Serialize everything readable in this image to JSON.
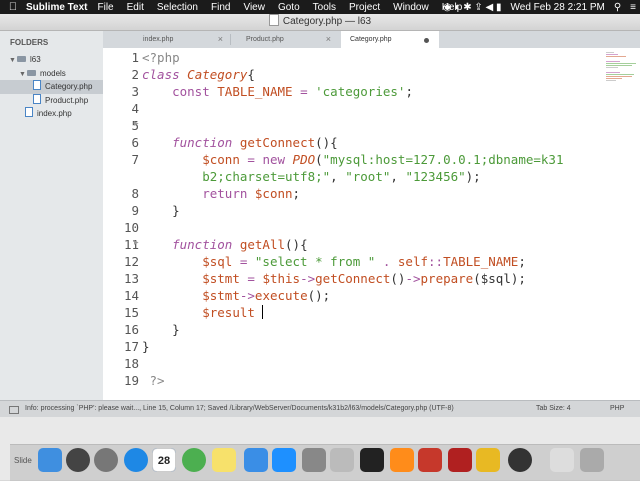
{
  "menubar": {
    "app_name": "Sublime Text",
    "menus": [
      "File",
      "Edit",
      "Selection",
      "Find",
      "View",
      "Goto",
      "Tools",
      "Project",
      "Window",
      "Help"
    ],
    "clock": "Wed Feb 28  2:21 PM"
  },
  "window": {
    "title": "Category.php — l63"
  },
  "sidebar": {
    "header": "FOLDERS",
    "items": [
      {
        "label": "l63"
      },
      {
        "label": "models"
      },
      {
        "label": "Category.php"
      },
      {
        "label": "Product.php"
      },
      {
        "label": "index.php"
      }
    ]
  },
  "tabs": [
    {
      "label": "index.php"
    },
    {
      "label": "Product.php"
    },
    {
      "label": "Category.php"
    }
  ],
  "editor": {
    "line_numbers": [
      "1",
      "2",
      "3",
      "4",
      "5",
      "6",
      "7",
      "",
      "8",
      "9",
      "10",
      "11",
      "12",
      "13",
      "14",
      "15",
      "16",
      "17",
      "18",
      "19"
    ],
    "code": {
      "l1": "<?php",
      "l2_kw": "class",
      "l2_name": "Category",
      "l2_brace": "{",
      "l3_kw": "const",
      "l3_name": "TABLE_NAME",
      "l3_eq": " = ",
      "l3_str": "'categories'",
      "l3_end": ";",
      "l6_kw": "function",
      "l6_name": "getConnect",
      "l6_end": "(){",
      "l7_var": "$conn",
      "l7_eq": " = ",
      "l7_new": "new",
      "l7_cls": "PDO",
      "l7_open": "(",
      "l7_str1": "\"mysql:host=127.0.0.1;dbname=k31",
      "l7b_str1": "b2;charset=utf8;\"",
      "l7b_c1": ", ",
      "l7b_str2": "\"root\"",
      "l7b_c2": ", ",
      "l7b_str3": "\"123456\"",
      "l7b_end": ");",
      "l8_kw": "return",
      "l8_var": "$conn",
      "l8_end": ";",
      "l9": "}",
      "l11_kw": "function",
      "l11_name": "getAll",
      "l11_end": "(){",
      "l12_var": "$sql",
      "l12_eq": " = ",
      "l12_str": "\"select * from \"",
      "l12_dot": " . ",
      "l12_self": "self",
      "l12_dc": "::",
      "l12_const": "TABLE_NAME",
      "l12_end": ";",
      "l13_var": "$stmt",
      "l13_eq": " = ",
      "l13_this": "$this",
      "l13_arr": "->",
      "l13_fn": "getConnect",
      "l13_p": "()",
      "l13_arr2": "->",
      "l13_fn2": "prepare",
      "l13_arg": "($sql);",
      "l14_var": "$stmt",
      "l14_arr": "->",
      "l14_fn": "execute",
      "l14_end": "();",
      "l15_var": "$result",
      "l16": "}",
      "l17": "}",
      "l19": "?>"
    }
  },
  "statusbar": {
    "message": "Info: processing `PHP': please wait..., Line 15, Column 17; Saved /Library/WebServer/Documents/k31b2/l63/models/Category.php (UTF-8)",
    "tab_size": "Tab Size: 4",
    "syntax": "PHP"
  },
  "dock": {
    "slide_label": "Slide",
    "calendar_day": "28",
    "icons": [
      "finder-icon",
      "siri-icon",
      "launchpad-icon",
      "safari-icon",
      "trello-icon",
      "calendar-icon",
      "chrome-icon",
      "notes-icon",
      "messages-icon",
      "appstore-icon",
      "system-preferences-icon",
      "photos-icon",
      "terminal-icon",
      "sublime-icon",
      "powerpoint-icon",
      "filezilla-icon",
      "yellow-app-icon",
      "quicktime-icon",
      "finder-window-icon",
      "trash-icon"
    ],
    "colors": [
      "#3f8fe0",
      "#444",
      "#777",
      "#1e88e5",
      "#1565c0",
      "#fff",
      "#4caf50",
      "#f7e16b",
      "#3a8ee6",
      "#1e90ff",
      "#888",
      "#bbb",
      "#222",
      "#ff8c1a",
      "#c6382b",
      "#b02020",
      "#e8b923",
      "#333",
      "#ddd",
      "#aaa"
    ]
  },
  "colors": {
    "keyword": "#a2529e",
    "entity": "#c14e22",
    "string": "#4c9a39",
    "selection": "#c7ccd1"
  }
}
